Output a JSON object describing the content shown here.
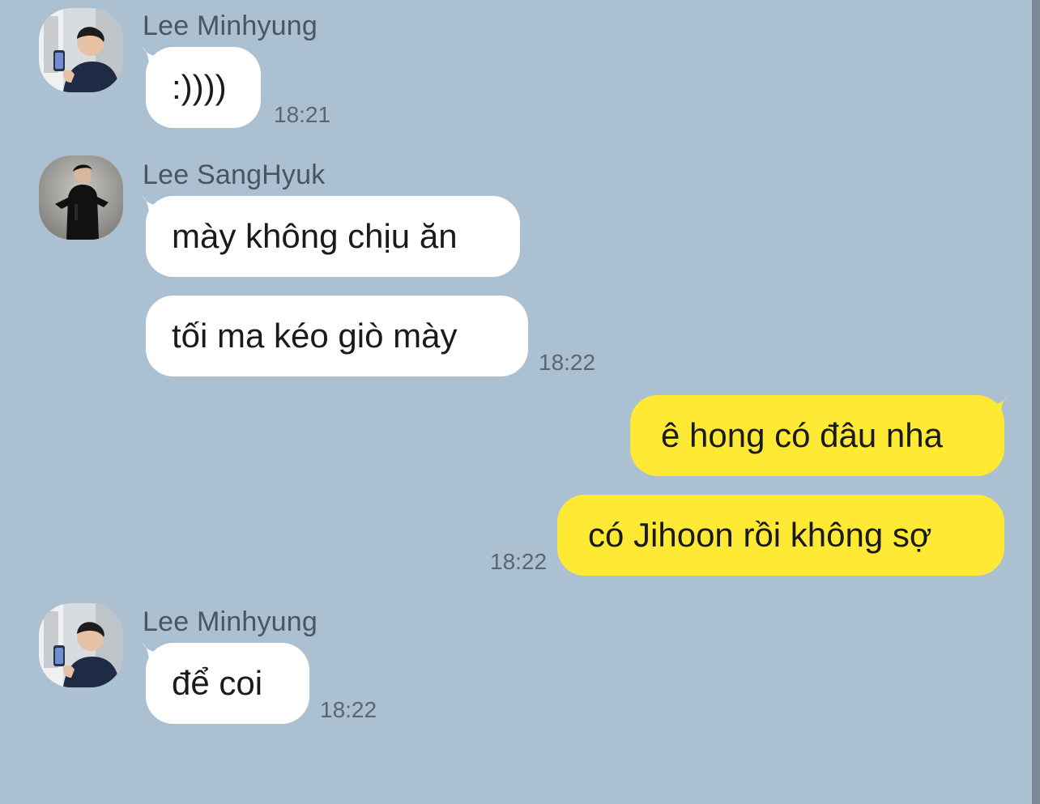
{
  "messages": [
    {
      "sender": "Lee Minhyung",
      "avatar_icon": "person-holding-phone-avatar",
      "bubbles": [
        "",
        ":))))"
      ],
      "time": "18:21"
    },
    {
      "sender": "Lee SangHyuk",
      "avatar_icon": "person-in-black-avatar",
      "bubbles": [
        "mày không chịu ăn",
        "tối ma kéo giò mày"
      ],
      "time": "18:22"
    },
    {
      "sender": "",
      "outgoing": true,
      "bubbles": [
        "ê hong có đâu nha",
        "có Jihoon rồi không sợ"
      ],
      "time": "18:22"
    },
    {
      "sender": "Lee Minhyung",
      "avatar_icon": "person-holding-phone-avatar",
      "bubbles": [
        "để coi"
      ],
      "time": "18:22"
    }
  ],
  "colors": {
    "background": "#abc1d1",
    "incoming_bubble": "#ffffff",
    "outgoing_bubble": "#fee934",
    "sender_text": "#4a5563",
    "time_text": "#5b6672"
  }
}
